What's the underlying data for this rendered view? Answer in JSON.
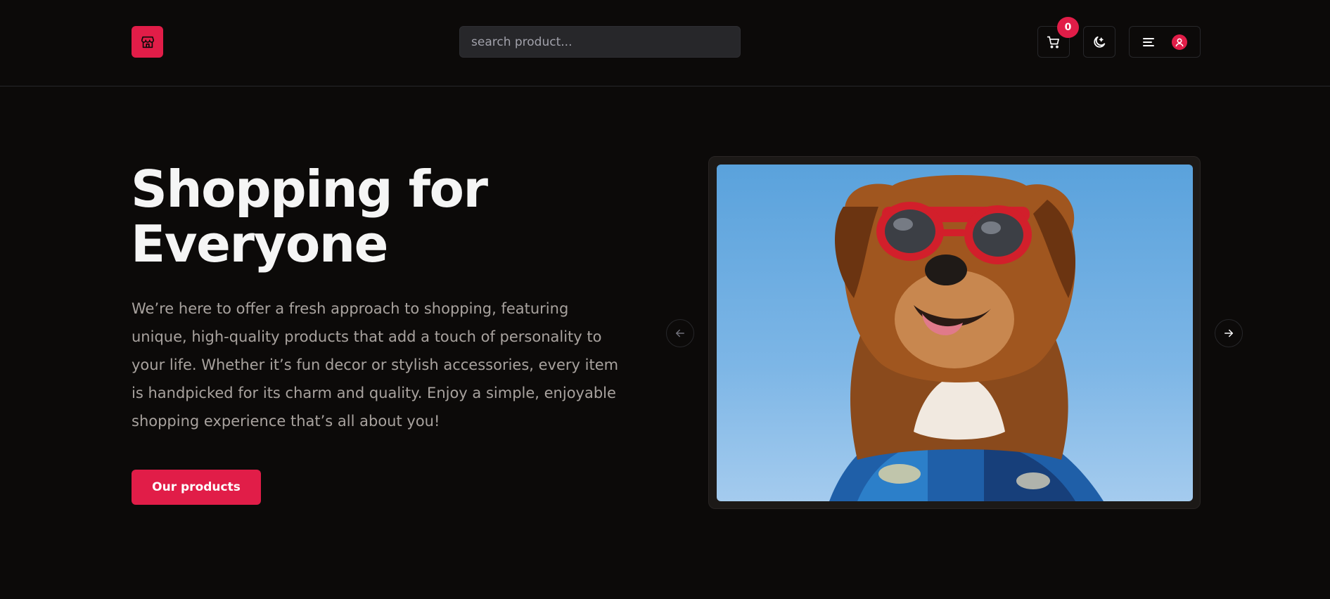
{
  "header": {
    "logo_icon": "store-icon",
    "search_placeholder": "search product...",
    "cart_count": "0",
    "cart_icon": "cart-icon",
    "theme_icon": "moon-icon",
    "menu_icon": "menu-icon",
    "user_icon": "user-icon"
  },
  "hero": {
    "title": "Shopping for Everyone",
    "description": "We’re here to offer a fresh approach to shopping, featuring unique, high-quality products that add a touch of personality to your life. Whether it’s fun decor or stylish accessories, every item is handpicked for its charm and quality. Enjoy a simple, enjoyable shopping experience that’s all about you!",
    "cta_label": "Our products"
  },
  "carousel": {
    "prev_icon": "arrow-left-icon",
    "next_icon": "arrow-right-icon"
  },
  "colors": {
    "background": "#0c0a09",
    "accent": "#e11d48",
    "muted_text": "#a8a29e",
    "border": "#27272a"
  }
}
